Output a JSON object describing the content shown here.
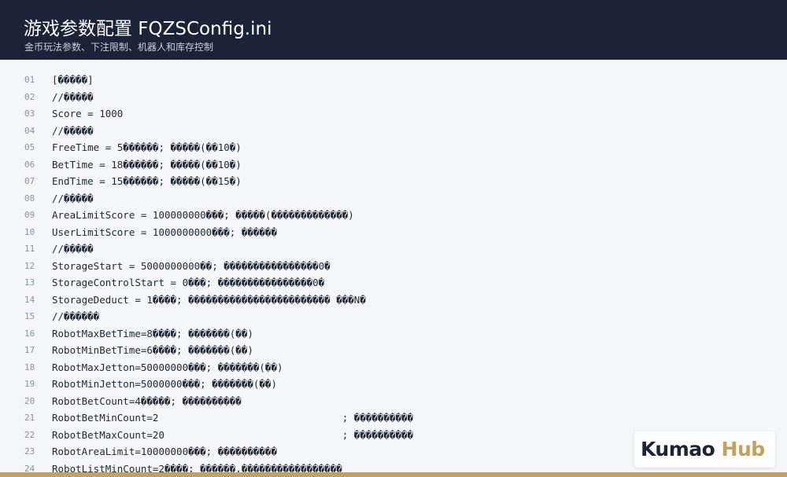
{
  "header": {
    "title": "游戏参数配置 FQZSConfig.ini",
    "subtitle": "金币玩法参数、下注限制、机器人和库存控制"
  },
  "colors": {
    "header_bg": "#1b2338",
    "accent": "#c2a25a",
    "page_bg": "#f4f6f9"
  },
  "code_lines": [
    {
      "num": "01",
      "text": "[�����]"
    },
    {
      "num": "02",
      "text": "//�����"
    },
    {
      "num": "03",
      "text": "Score = 1000"
    },
    {
      "num": "04",
      "text": "//�����"
    },
    {
      "num": "05",
      "text": "FreeTime = 5������; �����(��10�)"
    },
    {
      "num": "06",
      "text": "BetTime = 18������; �����(��10�)"
    },
    {
      "num": "07",
      "text": "EndTime = 15������; �����(��15�)"
    },
    {
      "num": "08",
      "text": "//�����"
    },
    {
      "num": "09",
      "text": "AreaLimitScore = 100000000���; �����(�������������)"
    },
    {
      "num": "10",
      "text": "UserLimitScore = 1000000000���; ������"
    },
    {
      "num": "11",
      "text": "//�����"
    },
    {
      "num": "12",
      "text": "StorageStart = 5000000000��; ����������������0�"
    },
    {
      "num": "13",
      "text": "StorageControlStart = 0���; ����������������0�"
    },
    {
      "num": "14",
      "text": "StorageDeduct = 1����; ������������������������ ���N�"
    },
    {
      "num": "15",
      "text": "//������"
    },
    {
      "num": "16",
      "text": "RobotMaxBetTime=8����; �������(��)"
    },
    {
      "num": "17",
      "text": "RobotMinBetTime=6����; �������(��)"
    },
    {
      "num": "18",
      "text": "RobotMaxJetton=50000000���; �������(��)"
    },
    {
      "num": "19",
      "text": "RobotMinJetton=5000000���; �������(��)"
    },
    {
      "num": "20",
      "text": "RobotBetCount=4�����; ����������"
    },
    {
      "num": "21",
      "text": "RobotBetMinCount=2                               ; ����������"
    },
    {
      "num": "22",
      "text": "RobotBetMaxCount=20                              ; ����������"
    },
    {
      "num": "23",
      "text": "RobotAreaLimit=10000000���; ����������"
    },
    {
      "num": "24",
      "text": "RobotListMinCount=2����; ������,�����������������"
    }
  ],
  "brand": {
    "name_part1": "Kumao",
    "name_part2": "Hub"
  }
}
